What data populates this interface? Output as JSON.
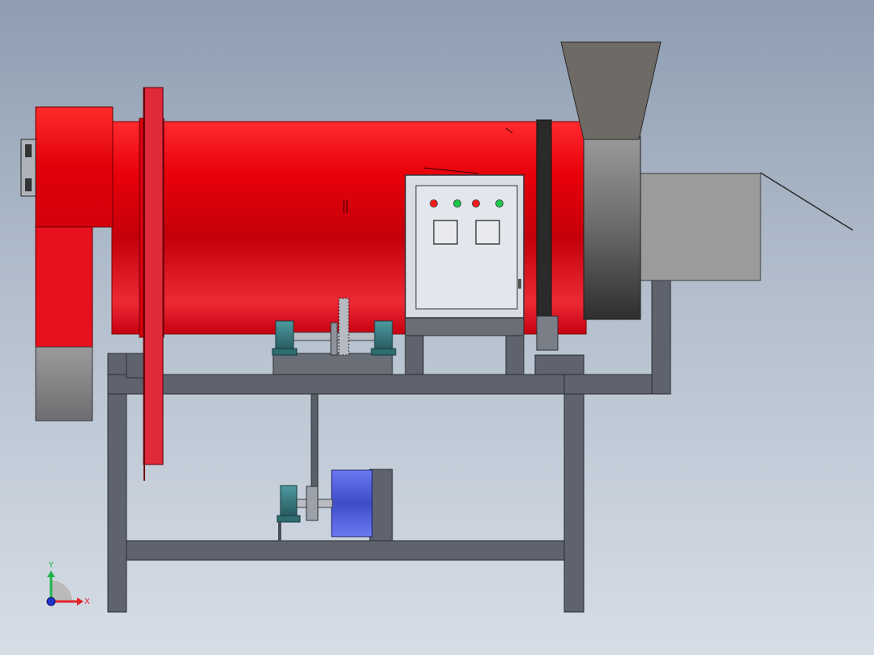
{
  "view": {
    "background_top": "#8e9db1",
    "background_bottom": "#d6dde6"
  },
  "machine": {
    "drum_color": "#e8000a",
    "frame_color": "#626670",
    "hopper_color": "#6e6a66",
    "discharge_color": "#9a9a9c",
    "motor_color": "#4c5ad8",
    "bearing_color": "#2d6c70",
    "panel_color": "#d8dbe2",
    "indicator_lights": [
      {
        "color": "#ff1a1a"
      },
      {
        "color": "#19c94a"
      },
      {
        "color": "#ff1a1a"
      },
      {
        "color": "#19c94a"
      }
    ]
  },
  "triad": {
    "y_label": "Y",
    "x_label": "X",
    "y_color": "#1db34a",
    "x_color": "#e3232a",
    "z_color": "#2233cc"
  }
}
